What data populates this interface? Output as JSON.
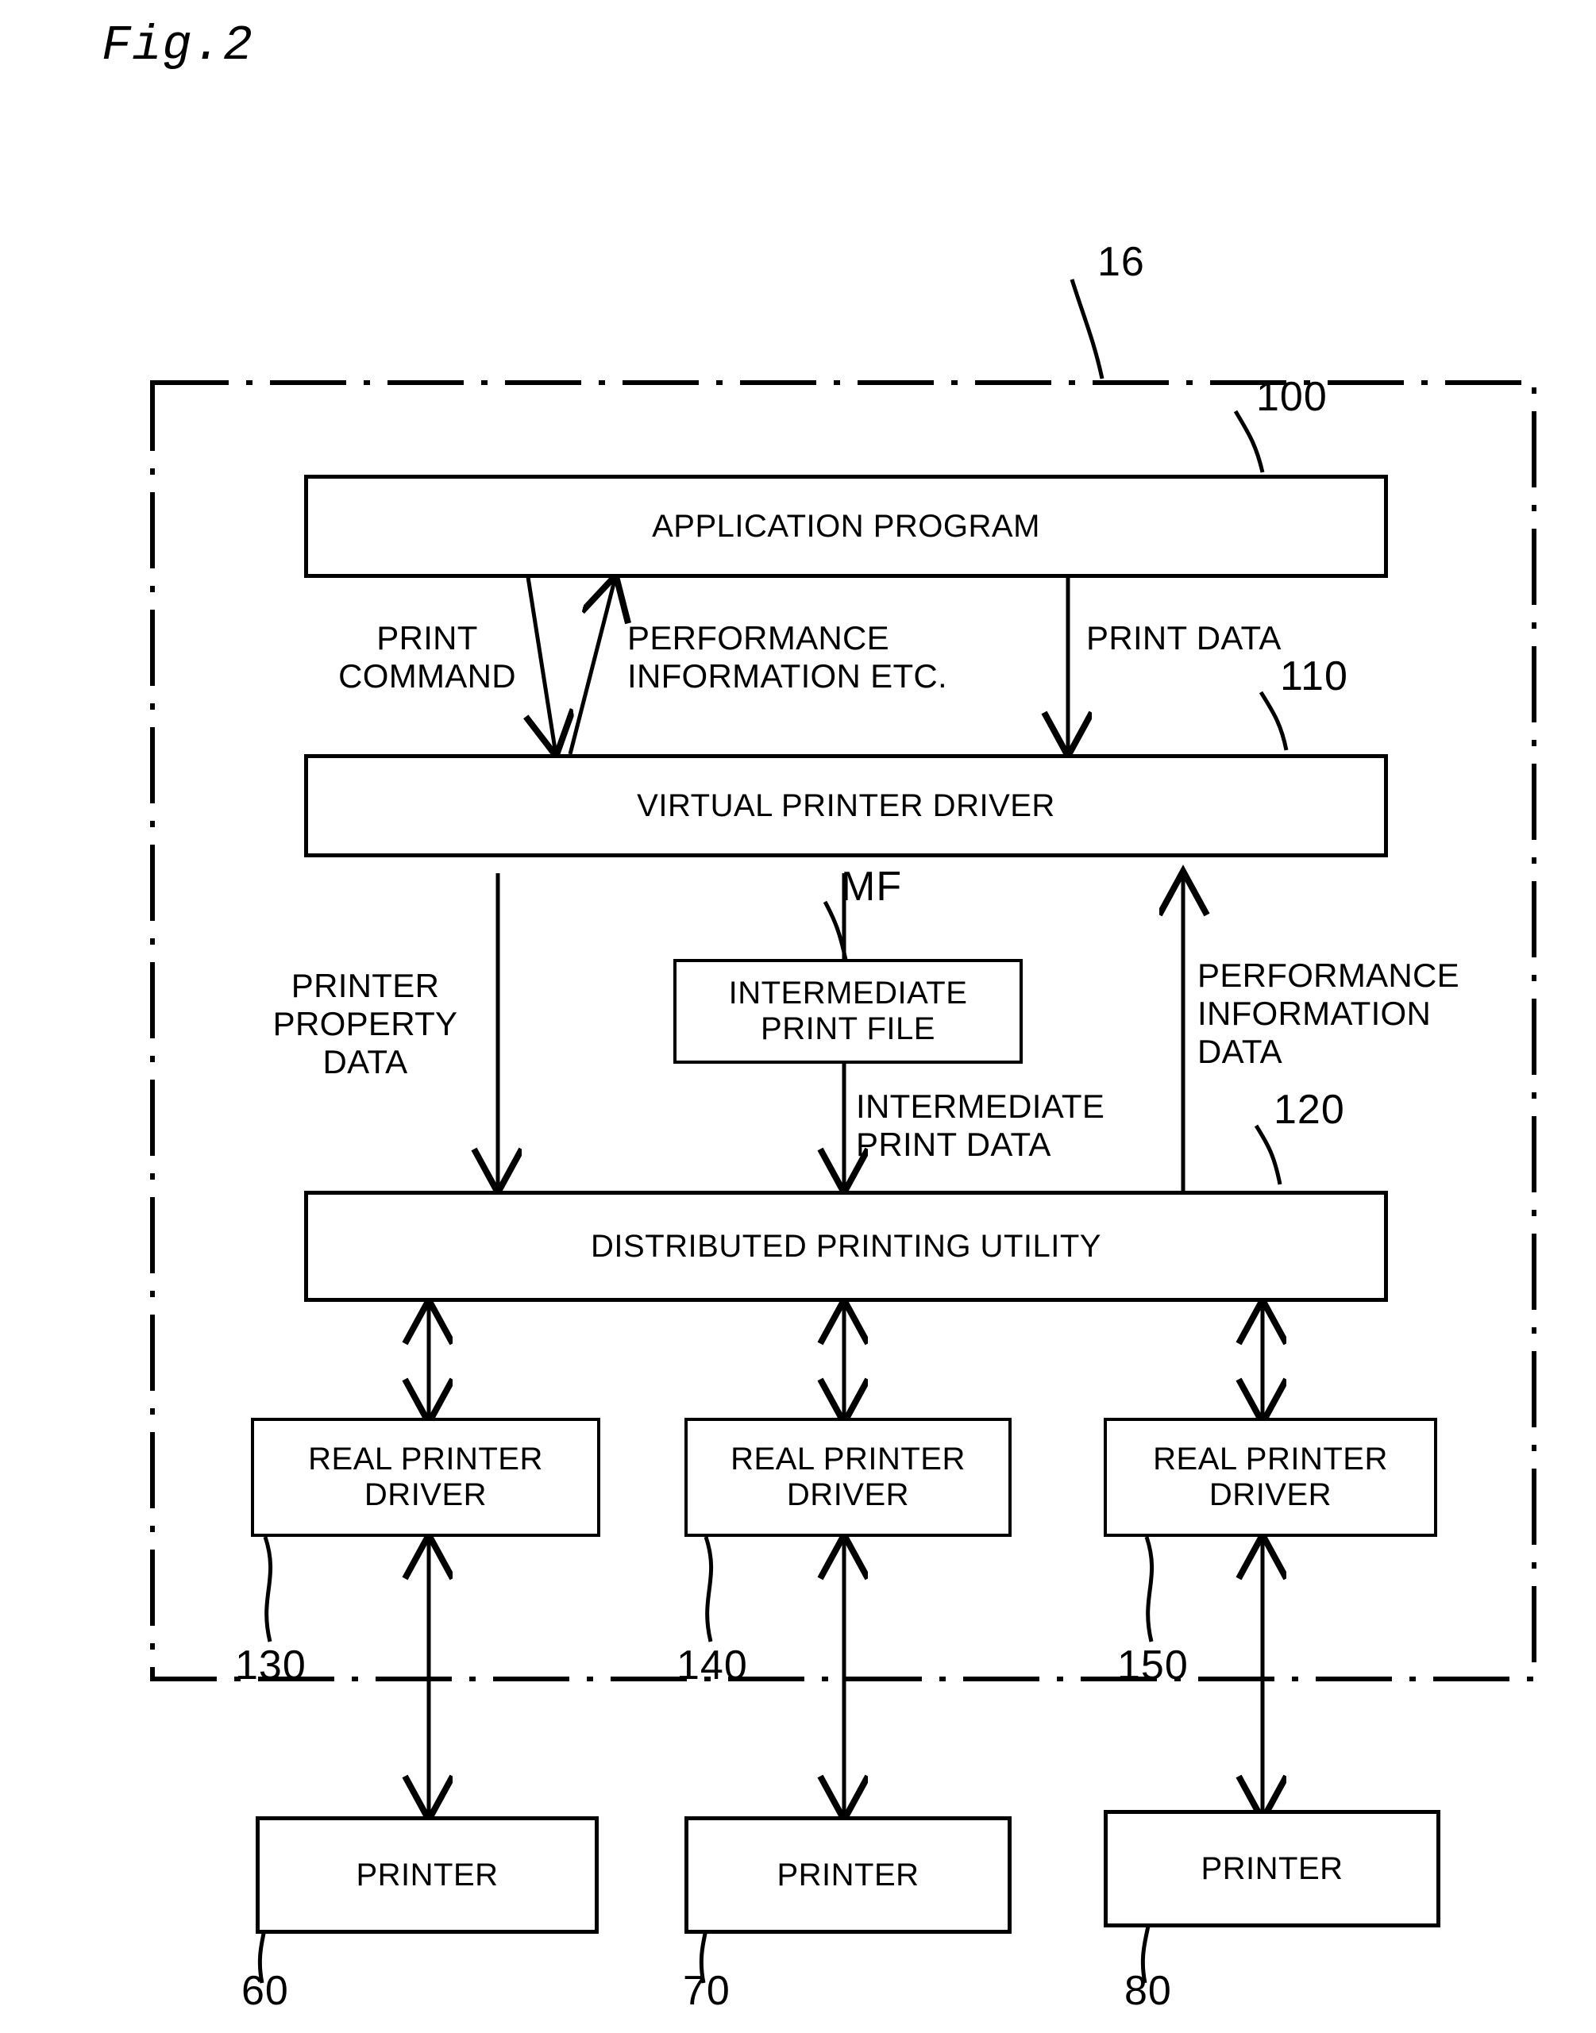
{
  "figure": {
    "title": "Fig.2",
    "system_ref": "16"
  },
  "nodes": {
    "application_program": {
      "label": "APPLICATION PROGRAM",
      "ref": "100"
    },
    "virtual_printer_driver": {
      "label": "VIRTUAL PRINTER DRIVER",
      "ref": "110"
    },
    "intermediate_print_file": {
      "label": "INTERMEDIATE\nPRINT FILE",
      "ref": "MF"
    },
    "distributed_printing_utility": {
      "label": "DISTRIBUTED PRINTING UTILITY",
      "ref": "120"
    },
    "real_printer_driver_1": {
      "label": "REAL PRINTER\nDRIVER",
      "ref": "130"
    },
    "real_printer_driver_2": {
      "label": "REAL PRINTER\nDRIVER",
      "ref": "140"
    },
    "real_printer_driver_3": {
      "label": "REAL PRINTER\nDRIVER",
      "ref": "150"
    },
    "printer_1": {
      "label": "PRINTER",
      "ref": "60"
    },
    "printer_2": {
      "label": "PRINTER",
      "ref": "70"
    },
    "printer_3": {
      "label": "PRINTER",
      "ref": "80"
    }
  },
  "flow_labels": {
    "print_command": "PRINT\nCOMMAND",
    "performance_information_etc": "PERFORMANCE\nINFORMATION ETC.",
    "print_data": "PRINT DATA",
    "printer_property_data": "PRINTER\nPROPERTY\nDATA",
    "intermediate_print_data": "INTERMEDIATE\nPRINT DATA",
    "performance_information_data": "PERFORMANCE\nINFORMATION\nDATA"
  },
  "colors": {
    "ink": "#000000",
    "paper": "#ffffff"
  }
}
